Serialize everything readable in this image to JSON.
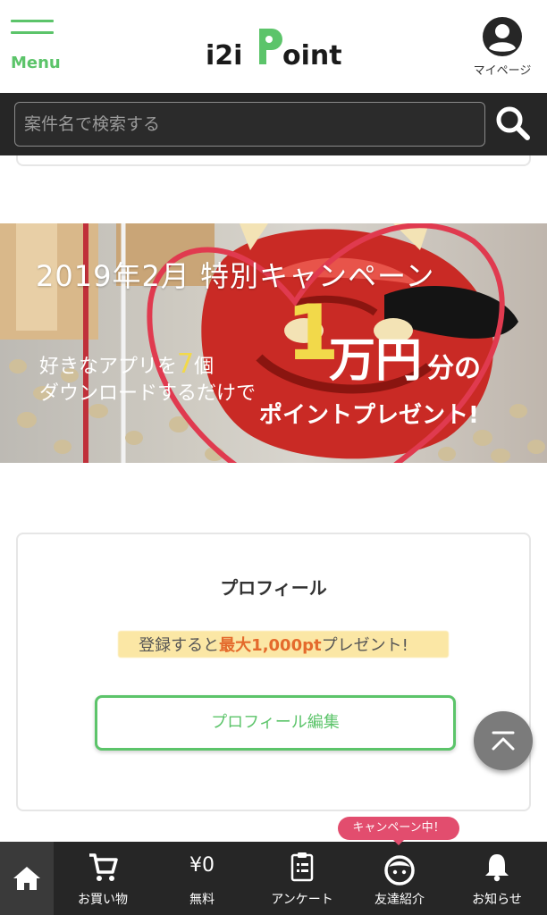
{
  "header": {
    "menu_label": "Menu",
    "logo_text": "i2iPoint",
    "mypage_label": "マイページ",
    "accent_color": "#5cc46a"
  },
  "search": {
    "placeholder": "案件名で検索する",
    "icon": "search-icon"
  },
  "banner": {
    "title": "2019年2月 特別キャンペーン",
    "line1_prefix": "好きなアプリを",
    "line1_number": "7",
    "line1_suffix": "個",
    "line2": "ダウンロードするだけで",
    "big_number": "1",
    "big_unit": "万円",
    "big_suffix": "分の",
    "line3": "ポイントプレゼント!"
  },
  "profile": {
    "title": "プロフィール",
    "promo_prefix": "登録すると",
    "promo_emph": "最大1,000pt",
    "promo_suffix": "プレゼント!",
    "edit_button": "プロフィール編集"
  },
  "bottom_nav": {
    "campaign_badge": "キャンペーン中！",
    "items": [
      {
        "label": "",
        "icon": "home-icon"
      },
      {
        "label": "お買い物",
        "icon": "cart-icon"
      },
      {
        "label": "無料",
        "value": "¥0"
      },
      {
        "label": "アンケート",
        "icon": "clipboard-icon"
      },
      {
        "label": "友達紹介",
        "icon": "face-icon"
      },
      {
        "label": "お知らせ",
        "icon": "bell-icon"
      }
    ]
  }
}
